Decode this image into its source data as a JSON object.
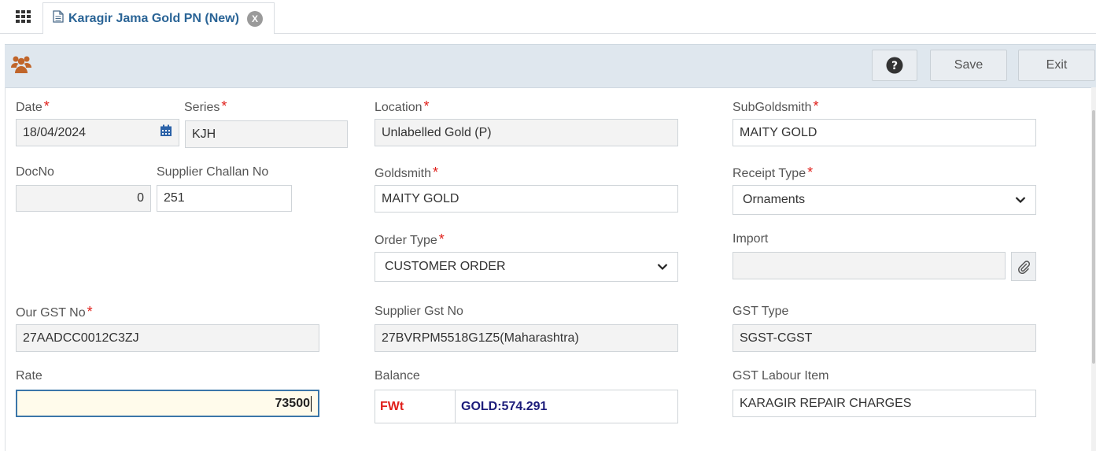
{
  "tab": {
    "title": "Karagir Jama Gold PN (New)",
    "close": "X"
  },
  "toolbar": {
    "help": "?",
    "save": "Save",
    "exit": "Exit"
  },
  "form": {
    "date": {
      "label": "Date",
      "value": "18/04/2024"
    },
    "series": {
      "label": "Series",
      "value": "KJH"
    },
    "location": {
      "label": "Location",
      "value": "Unlabelled Gold (P)"
    },
    "subgoldsmith": {
      "label": "SubGoldsmith",
      "value": "MAITY GOLD"
    },
    "docno": {
      "label": "DocNo",
      "value": "0"
    },
    "supplier_challan": {
      "label": "Supplier Challan No",
      "value": "251"
    },
    "goldsmith": {
      "label": "Goldsmith",
      "value": "MAITY GOLD"
    },
    "receipt_type": {
      "label": "Receipt Type",
      "value": "Ornaments"
    },
    "order_type": {
      "label": "Order Type",
      "value": "CUSTOMER ORDER"
    },
    "import": {
      "label": "Import",
      "value": ""
    },
    "our_gst": {
      "label": "Our GST No",
      "value": "27AADCC0012C3ZJ"
    },
    "supplier_gst": {
      "label": "Supplier Gst No",
      "value": "27BVRPM5518G1Z5(Maharashtra)"
    },
    "gst_type": {
      "label": "GST Type",
      "value": "SGST-CGST"
    },
    "rate": {
      "label": "Rate",
      "value": "73500"
    },
    "balance": {
      "label": "Balance",
      "key": "FWt",
      "value": "GOLD:574.291"
    },
    "gst_labour": {
      "label": "GST Labour Item",
      "value": "KARAGIR REPAIR CHARGES"
    }
  },
  "required_mark": "*",
  "colors": {
    "accent": "#2a6496",
    "required": "#e0201b",
    "toolbar_bg": "#dfe7ee"
  }
}
